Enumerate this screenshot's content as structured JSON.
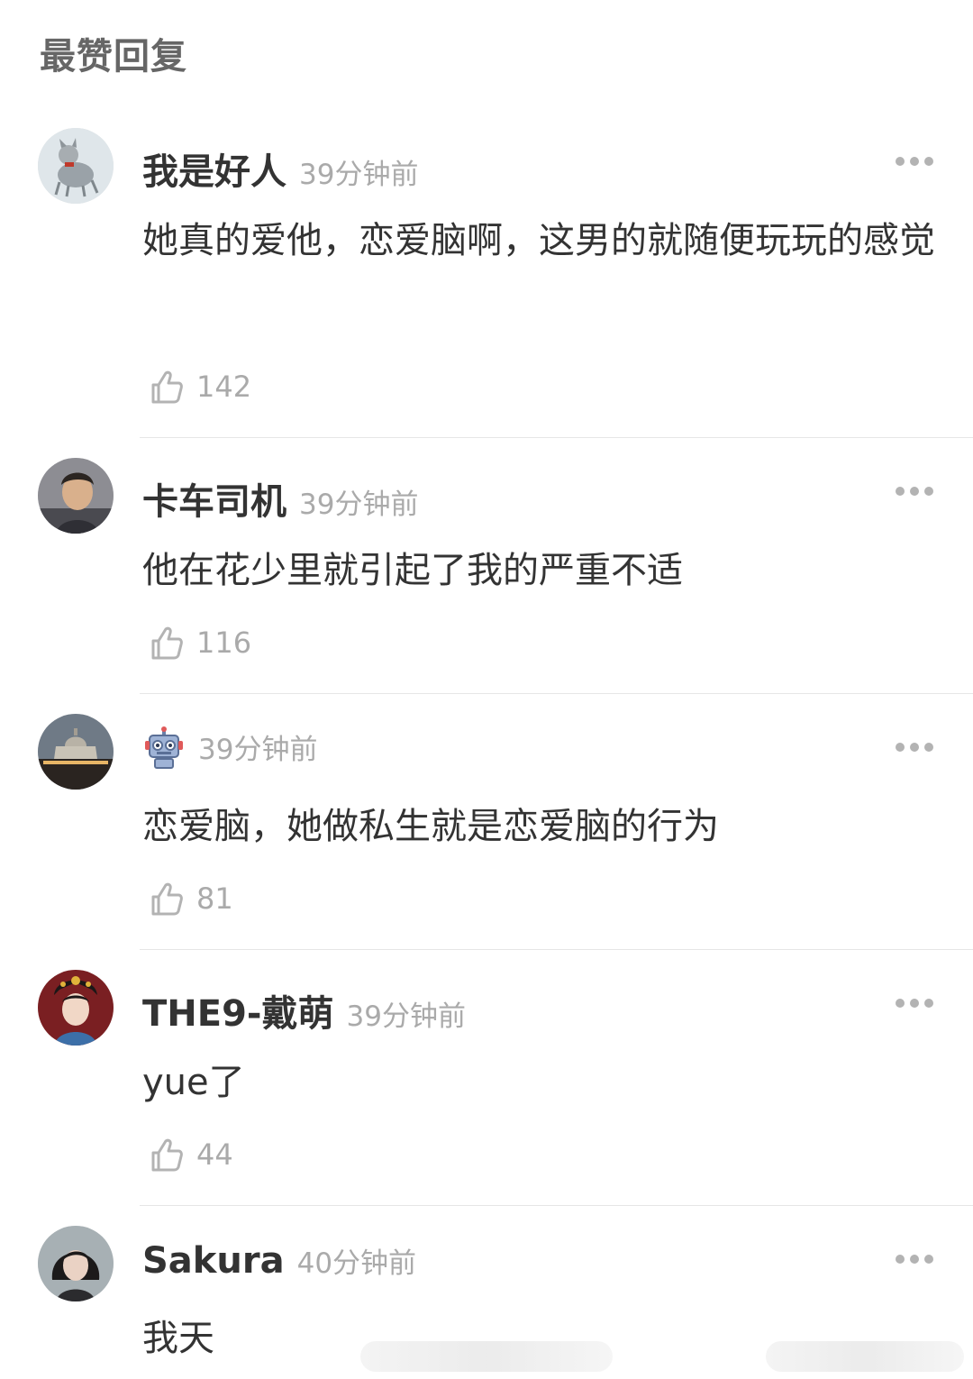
{
  "section_title": "最赞回复",
  "comments": [
    {
      "username": "我是好人",
      "time": "39分钟前",
      "text": "她真的爱他，恋爱脑啊，这男的就随便玩玩的感觉",
      "likes": "142"
    },
    {
      "username": "卡车司机",
      "time": "39分钟前",
      "text": "他在花少里就引起了我的严重不适",
      "likes": "116"
    },
    {
      "username": "",
      "time": "39分钟前",
      "text": "恋爱脑，她做私生就是恋爱脑的行为",
      "likes": "81"
    },
    {
      "username": "THE9-戴萌",
      "time": "39分钟前",
      "text": "yue了",
      "likes": "44"
    },
    {
      "username": "Sakura",
      "time": "40分钟前",
      "text": "我天",
      "likes": ""
    }
  ],
  "icons": {
    "like": "thumbs-up-icon",
    "more": "more-dots-icon",
    "badge": "robot-icon"
  },
  "colors": {
    "username": "#333333",
    "meta": "#aaaaaa",
    "divider": "#e6e6e6",
    "title": "#666666"
  }
}
